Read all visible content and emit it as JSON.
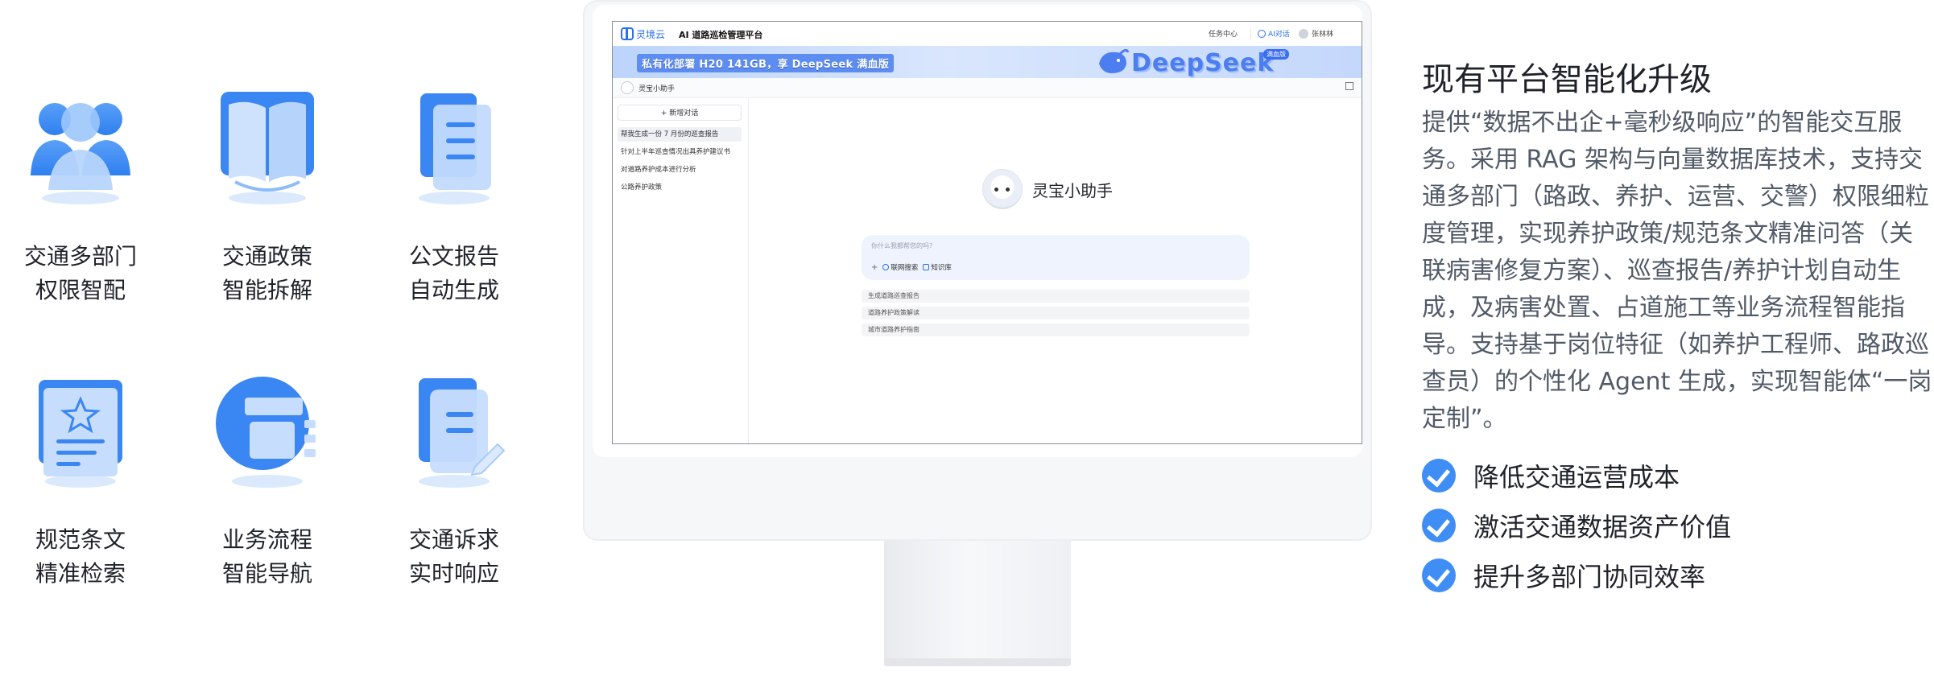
{
  "features": [
    {
      "icon": "people-icon",
      "line1": "交通多部门",
      "line2": "权限智配"
    },
    {
      "icon": "book-icon",
      "line1": "交通政策",
      "line2": "智能拆解"
    },
    {
      "icon": "document-icon",
      "line1": "公文报告",
      "line2": "自动生成"
    },
    {
      "icon": "certificate-icon",
      "line1": "规范条文",
      "line2": "精准检索"
    },
    {
      "icon": "flowchart-icon",
      "line1": "业务流程",
      "line2": "智能导航"
    },
    {
      "icon": "edit-document-icon",
      "line1": "交通诉求",
      "line2": "实时响应"
    }
  ],
  "app": {
    "logo": "灵境云",
    "title": "AI 道路巡检管理平台",
    "nav": {
      "task_center": "任务中心",
      "ai_chat": "AI对话",
      "user": "张林林"
    },
    "banner": {
      "text": "私有化部署 H20 141GB，享 DeepSeek 满血版",
      "brand": "DeepSeek",
      "badge": "满血版"
    },
    "assistant_bar_title": "灵宝小助手",
    "sidebar": {
      "new_chat": "+ 新增对话",
      "history": [
        "帮我生成一份 7 月份的巡查报告",
        "针对上半年巡查情况出具养护建议书",
        "对道路养护成本进行分析",
        "公路养护政策"
      ]
    },
    "main": {
      "assistant_name": "灵宝小助手",
      "input_placeholder": "你什么我都帮您的吗?",
      "tools": {
        "plus": "+",
        "web_search": "联网搜索",
        "knowledge": "知识库"
      },
      "suggestions": [
        "生成道路巡查报告",
        "道路养护政策解读",
        "城市道路养护指南"
      ]
    }
  },
  "right": {
    "heading": "现有平台智能化升级",
    "description": "提供“数据不出企+毫秒级响应”的智能交互服务。采用 RAG 架构与向量数据库技术，支持交通多部门（路政、养护、运营、交警）权限细粒度管理，实现养护政策/规范条文精准问答（关联病害修复方案）、巡查报告/养护计划自动生成，及病害处置、占道施工等业务流程智能指导。支持基于岗位特征（如养护工程师、路政巡查员）的个性化 Agent 生成，实现智能体“一岗定制”。",
    "benefits": [
      "降低交通运营成本",
      "激活交通数据资产价值",
      "提升多部门协同效率"
    ]
  },
  "colors": {
    "accent": "#3f8ef5",
    "brand": "#2a6ff2",
    "icon_light": "#bcd6fb"
  }
}
